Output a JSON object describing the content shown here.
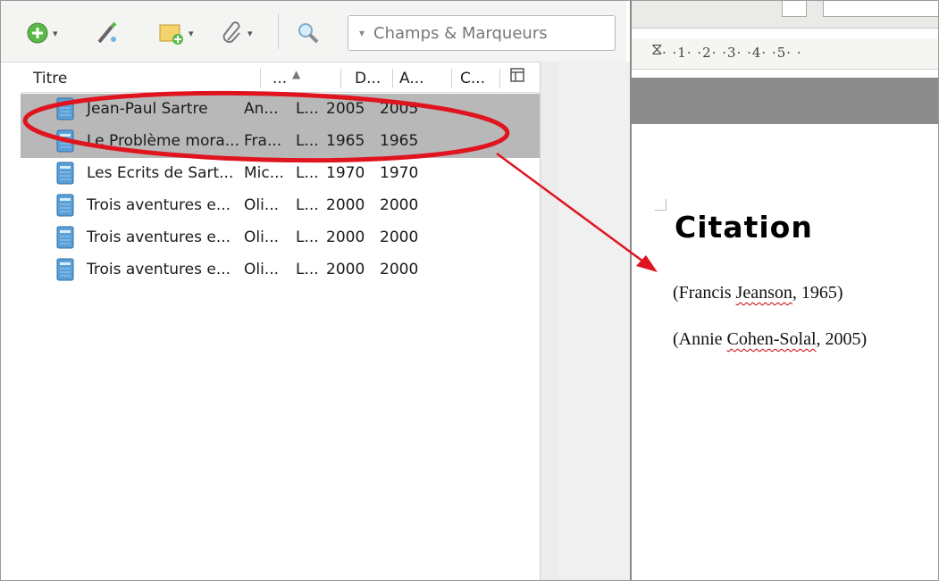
{
  "toolbar": {
    "new_item_icon": "plus-circle-icon",
    "new_note_icon": "wand-icon",
    "add_attachment_icon": "image-add-icon",
    "link_icon": "paperclip-icon",
    "search_icon": "magnifier-icon",
    "search_mode": "Champs & Marqueurs"
  },
  "columns": {
    "title": "Titre",
    "creator": "...",
    "date": "D...",
    "year": "A...",
    "extra": "C..."
  },
  "rows": [
    {
      "title": "Jean-Paul Sartre",
      "creator": "An...",
      "type": "L...",
      "date": "2005",
      "year": "2005",
      "selected": true
    },
    {
      "title": "Le Problème mora...",
      "creator": "Fra...",
      "type": "L...",
      "date": "1965",
      "year": "1965",
      "selected": true
    },
    {
      "title": "Les Ecrits de Sart...",
      "creator": "Mic...",
      "type": "L...",
      "date": "1970",
      "year": "1970",
      "selected": false
    },
    {
      "title": "Trois aventures e...",
      "creator": "Oli...",
      "type": "L...",
      "date": "2000",
      "year": "2000",
      "selected": false
    },
    {
      "title": "Trois aventures e...",
      "creator": "Oli...",
      "type": "L...",
      "date": "2000",
      "year": "2000",
      "selected": false
    },
    {
      "title": "Trois aventures e...",
      "creator": "Oli...",
      "type": "L...",
      "date": "2000",
      "year": "2000",
      "selected": false
    }
  ],
  "ruler": {
    "marks": "· ·1· ·2· ·3· ·4· ·5· ·"
  },
  "document": {
    "heading": "Citation",
    "citations": [
      {
        "open": "(Francis ",
        "name": "Jeanson",
        "close": ", 1965)"
      },
      {
        "open": "(Annie ",
        "name": "Cohen-Solal",
        "close": ", 2005)"
      }
    ]
  },
  "colors": {
    "selection": "#b8b8b8",
    "annotation": "#e0141e"
  }
}
